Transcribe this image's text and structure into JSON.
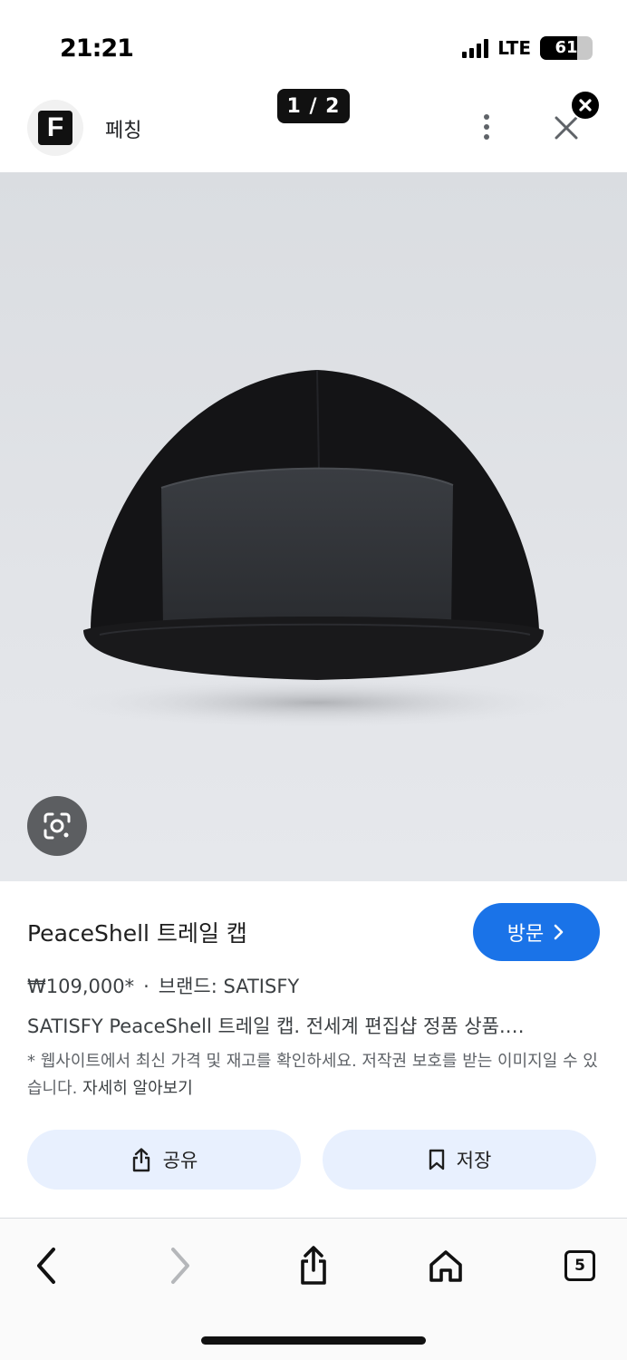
{
  "status_bar": {
    "time": "21:21",
    "network": "LTE",
    "battery": "61"
  },
  "header": {
    "site_name": "페칭",
    "site_logo_letter": "F",
    "image_counter": "1 / 2"
  },
  "product": {
    "title": "PeaceShell 트레일 캡",
    "visit_label": "방문",
    "price": "₩109,000*",
    "separator": "·",
    "brand": "브랜드: SATISFY",
    "description": "SATISFY PeaceShell 트레일 캡. 전세계 편집샵 정품 상품.…",
    "note": "* 웹사이트에서 최신 가격 및 재고를 확인하세요. 저작권 보호를 받는 이미지일 수 있습니다.",
    "learn_more": "자세히 알아보기"
  },
  "actions": {
    "share_label": "공유",
    "save_label": "저장"
  },
  "toolbar": {
    "tab_count": "5"
  },
  "colors": {
    "accent": "#1a73e8",
    "action_bg": "#e8f0fe",
    "image_bg": "#dfe1e5"
  }
}
